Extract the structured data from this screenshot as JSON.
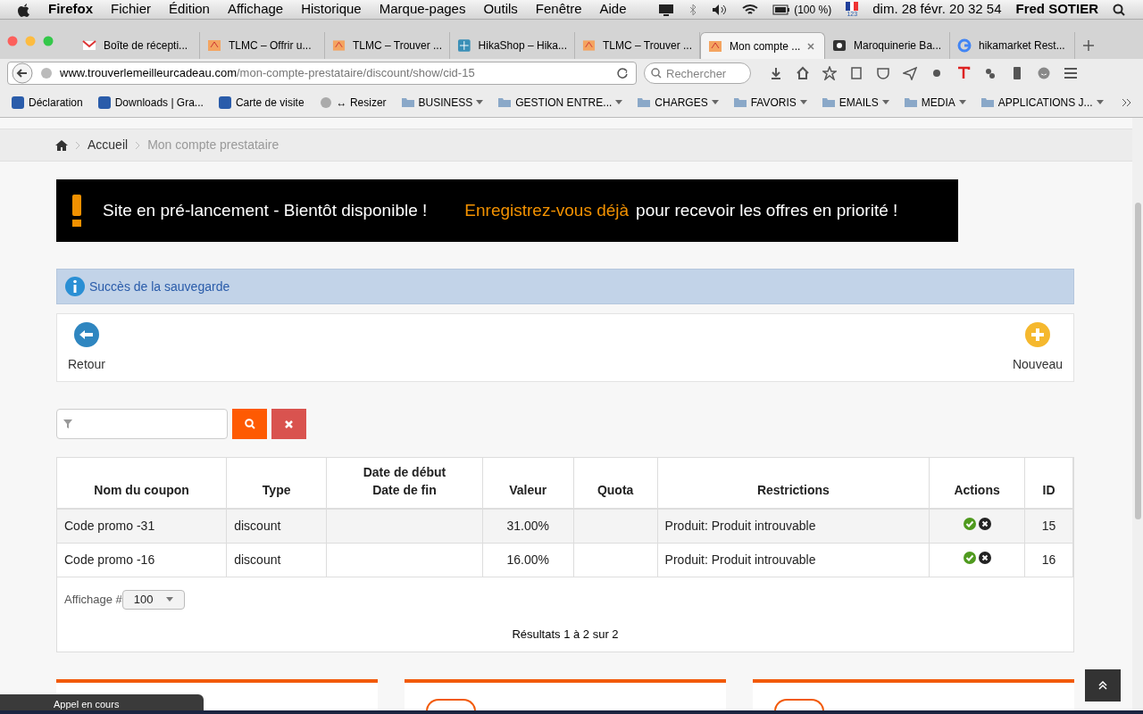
{
  "menubar": {
    "app": "Firefox",
    "menus": [
      "Fichier",
      "Édition",
      "Affichage",
      "Historique",
      "Marque-pages",
      "Outils",
      "Fenêtre",
      "Aide"
    ],
    "battery": "(100 %)",
    "keyboard": "123",
    "clock": "dim. 28 févr.  20 32 54",
    "user": "Fred SOTIER"
  },
  "tabs": [
    {
      "label": "Boîte de récepti...",
      "kind": "mail",
      "selected": false
    },
    {
      "label": "TLMC – Offrir u...",
      "kind": "tlmc",
      "selected": false
    },
    {
      "label": "TLMC – Trouver ...",
      "kind": "tlmc",
      "selected": false
    },
    {
      "label": "HikaShop – Hika...",
      "kind": "hika",
      "selected": false
    },
    {
      "label": "TLMC – Trouver ...",
      "kind": "tlmc",
      "selected": false
    },
    {
      "label": "Mon compte ...",
      "kind": "tlmc",
      "selected": true
    },
    {
      "label": "Maroquinerie Ba...",
      "kind": "generic",
      "selected": false
    },
    {
      "label": "hikamarket Rest...",
      "kind": "google",
      "selected": false
    }
  ],
  "address": {
    "host": "www.trouverlemeilleurcadeau.com",
    "path": "/mon-compte-prestataire/discount/show/cid-15"
  },
  "search": {
    "placeholder": "Rechercher"
  },
  "bookmarks": [
    {
      "label": "Déclaration",
      "kind": "site"
    },
    {
      "label": "Downloads | Gra...",
      "kind": "site"
    },
    {
      "label": "Carte de visite",
      "kind": "site"
    },
    {
      "label": "↔ Resizer",
      "kind": "globe"
    },
    {
      "label": "BUSINESS",
      "kind": "folder"
    },
    {
      "label": "GESTION ENTRE...",
      "kind": "folder"
    },
    {
      "label": "CHARGES",
      "kind": "folder"
    },
    {
      "label": "FAVORIS",
      "kind": "folder"
    },
    {
      "label": "EMAILS",
      "kind": "folder"
    },
    {
      "label": "MEDIA",
      "kind": "folder"
    },
    {
      "label": "APPLICATIONS J...",
      "kind": "folder"
    }
  ],
  "breadcrumb": [
    "Accueil",
    "Mon compte prestataire"
  ],
  "banner": {
    "text": "Site en pré-lancement - Bientôt disponible !",
    "link": "Enregistrez-vous déjà",
    "after": "pour recevoir les offres en priorité !"
  },
  "message": "Succès de la sauvegarde",
  "toolbar": {
    "back": "Retour",
    "new": "Nouveau"
  },
  "table": {
    "columns": [
      "Nom du coupon",
      "Type",
      "Date de début\nDate de fin",
      "Valeur",
      "Quota",
      "Restrictions",
      "Actions",
      "ID"
    ],
    "rows": [
      {
        "cells": [
          "Code promo -31",
          "discount",
          "",
          "31.00%",
          "",
          "Produit: Produit introuvable",
          "",
          "15"
        ]
      },
      {
        "cells": [
          "Code promo -16",
          "discount",
          "",
          "16.00%",
          "",
          "Produit: Produit introuvable",
          "",
          "16"
        ]
      }
    ]
  },
  "pagination": {
    "label": "Affichage #",
    "value": "100",
    "results": "Résultats 1 à 2 sur 2"
  },
  "notification": "Appel en cours"
}
